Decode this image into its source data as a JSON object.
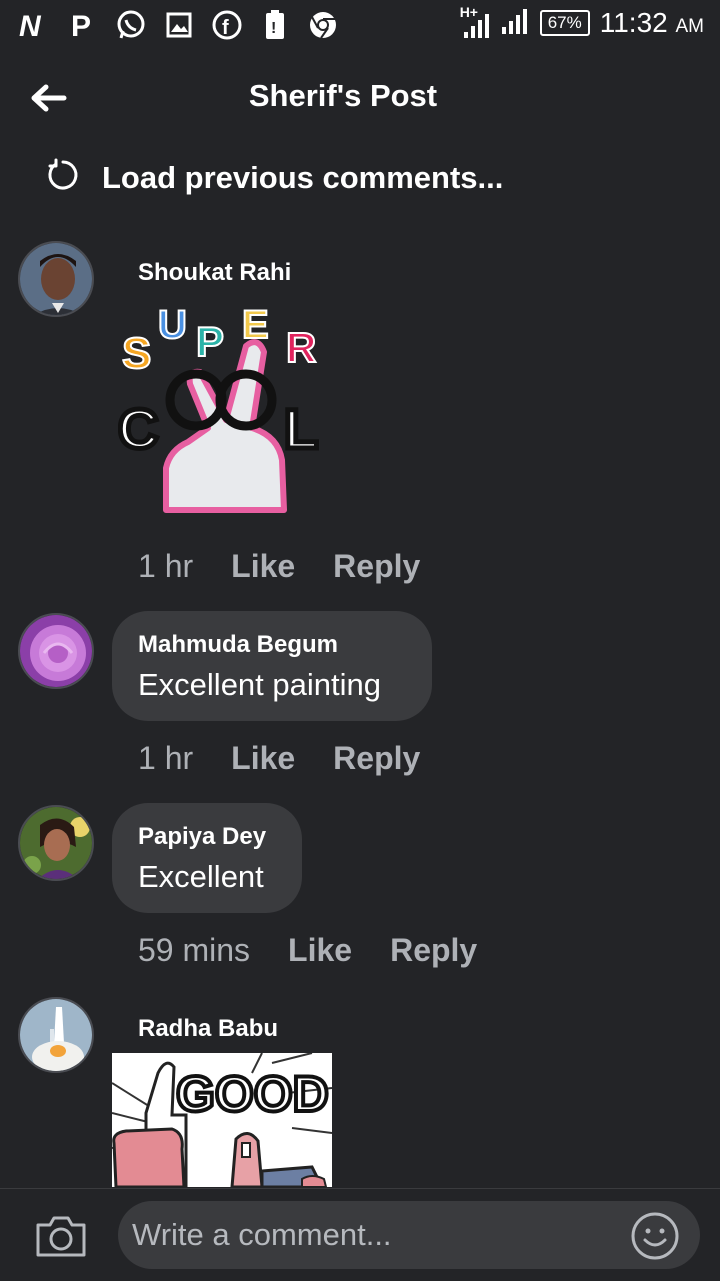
{
  "status_bar": {
    "icons": [
      "n-icon",
      "p-icon",
      "whatsapp-icon",
      "gallery-icon",
      "facebook-icon",
      "battery-alert-icon",
      "chrome-icon"
    ],
    "network": "H+",
    "battery": "67%",
    "time": "11:32",
    "ampm": "AM"
  },
  "header": {
    "title": "Sherif's Post"
  },
  "load_previous": "Load previous comments...",
  "comments": [
    {
      "name": "Shoukat Rahi",
      "sticker": "super-cool-sticker",
      "time": "1 hr",
      "like": "Like",
      "reply": "Reply"
    },
    {
      "name": "Mahmuda Begum",
      "text": "Excellent painting",
      "time": "1 hr",
      "like": "Like",
      "reply": "Reply"
    },
    {
      "name": "Papiya Dey",
      "text": "Excellent",
      "time": "59 mins",
      "like": "Like",
      "reply": "Reply"
    },
    {
      "name": "Radha Babu",
      "sticker": "good-thumbs-up-sticker"
    }
  ],
  "composer": {
    "placeholder": "Write a comment..."
  }
}
